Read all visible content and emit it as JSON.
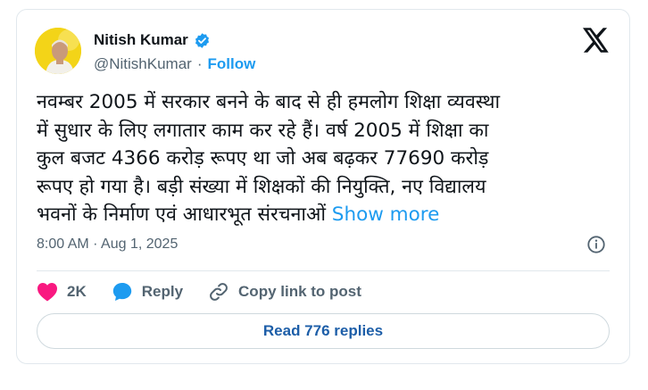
{
  "author": {
    "name": "Nitish Kumar",
    "handle": "@NitishKumar",
    "separator": "·",
    "follow_label": "Follow",
    "verified_color": "#1d9bf0"
  },
  "tweet": {
    "text": "नवम्बर 2005 में सरकार बनने के बाद से ही हमलोग शिक्षा व्यवस्था\nमें सुधार के लिए लगातार काम कर रहे हैं। वर्ष 2005 में शिक्षा का\nकुल बजट 4366 करोड़ रूपए था जो अब बढ़कर 77690 करोड़\nरूपए हो गया है। बड़ी संख्या में शिक्षकों की नियुक्ति, नए विद्यालय\nभवनों के निर्माण एवं आधारभूत संरचनाओं ",
    "show_more_label": "Show more",
    "timestamp": "8:00 AM · Aug 1, 2025"
  },
  "actions": {
    "like_count": "2K",
    "reply_label": "Reply",
    "copy_link_label": "Copy link to post"
  },
  "replies": {
    "button_label": "Read 776 replies"
  },
  "colors": {
    "accent": "#1d9bf0",
    "like": "#f91880",
    "muted": "#536471"
  }
}
